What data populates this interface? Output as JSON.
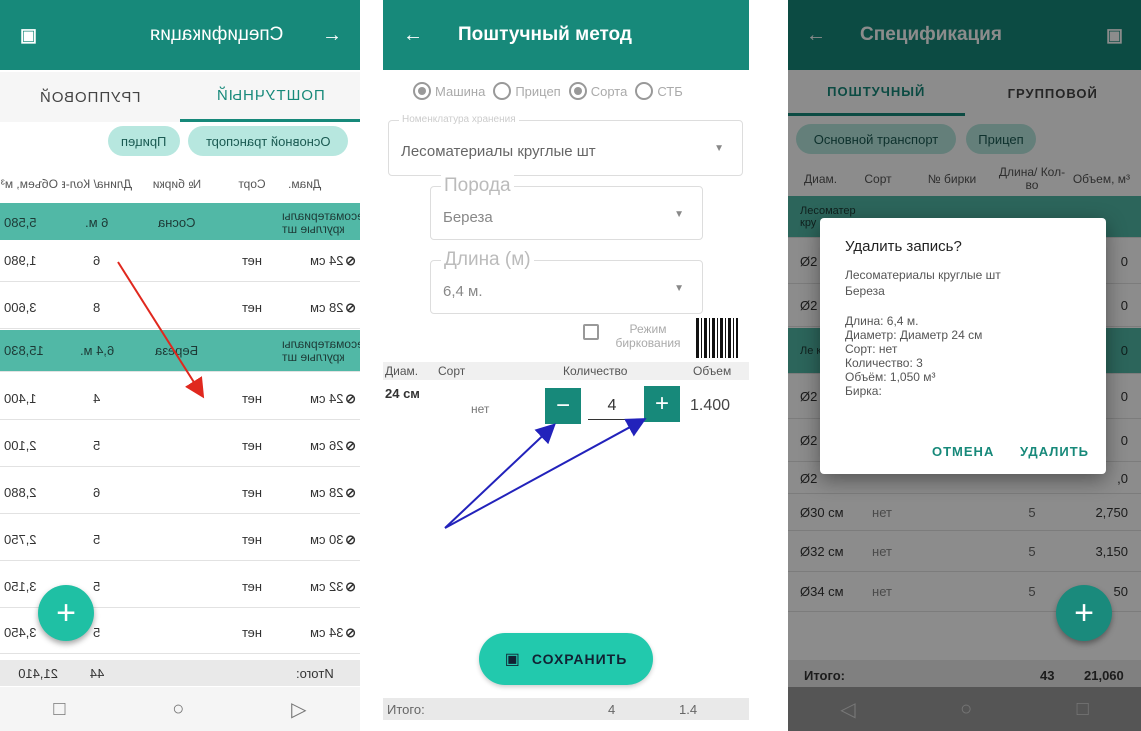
{
  "phone1": {
    "title": "Спецификация",
    "tabs": [
      "Групповой",
      "Поштучный"
    ],
    "chips": [
      "Прицеп",
      "Основной транспорт"
    ],
    "columns": [
      "Объем, м³",
      "Длина/ Кол-во",
      "№ бирки",
      "Сорт",
      "Диам."
    ],
    "rows": [
      {
        "type": "group",
        "volume": "5,580",
        "count": "6 м.",
        "tag": "Сосна",
        "sort": "",
        "diam": "Лесоматериалы круглые шт"
      },
      {
        "type": "item",
        "volume": "1,980",
        "count": "6",
        "tag": "",
        "sort": "нет",
        "diam": "24 см"
      },
      {
        "type": "item",
        "volume": "3,600",
        "count": "8",
        "tag": "",
        "sort": "нет",
        "diam": "28 см"
      },
      {
        "type": "group",
        "volume": "15,830",
        "count": "6,4 м.",
        "tag": "Береза",
        "sort": "",
        "diam": "Лесоматериалы круглые шт"
      },
      {
        "type": "item",
        "volume": "1,400",
        "count": "4",
        "tag": "",
        "sort": "нет",
        "diam": "24 см"
      },
      {
        "type": "item",
        "volume": "2,100",
        "count": "5",
        "tag": "",
        "sort": "нет",
        "diam": "26 см"
      },
      {
        "type": "item",
        "volume": "2,880",
        "count": "6",
        "tag": "",
        "sort": "нет",
        "diam": "28 см"
      },
      {
        "type": "item",
        "volume": "2,750",
        "count": "5",
        "tag": "",
        "sort": "нет",
        "diam": "30 см"
      },
      {
        "type": "item",
        "volume": "3,150",
        "count": "5",
        "tag": "",
        "sort": "нет",
        "diam": "32 см"
      },
      {
        "type": "item",
        "volume": "3,450",
        "count": "5",
        "tag": "",
        "sort": "нет",
        "diam": "34 см"
      }
    ],
    "totals": {
      "volume": "21,410",
      "count": "44",
      "label": "Итого:"
    }
  },
  "phone2": {
    "title": "Поштучный метод",
    "radios": [
      {
        "label": "Машина",
        "checked": true
      },
      {
        "label": "Прицеп",
        "checked": false
      },
      {
        "label": "Сорта",
        "checked": true
      },
      {
        "label": "СТБ",
        "checked": false
      }
    ],
    "nomenclature": {
      "label": "Номенклатура хранения",
      "value": "Лесоматериалы круглые шт"
    },
    "species": {
      "label": "Порода",
      "value": "Береза"
    },
    "length": {
      "label": "Длина (м)",
      "value": "6,4 м."
    },
    "tag_mode": "Режим биркования",
    "columns": {
      "diam": "Диам.",
      "sort": "Сорт",
      "qty": "Количество",
      "vol": "Объем"
    },
    "row": {
      "diam": "24 см",
      "sort": "нет",
      "qty": "4",
      "vol": "1.400"
    },
    "save_label": "СОХРАНИТЬ",
    "totals": {
      "label": "Итого:",
      "qty": "4",
      "vol": "1.4"
    }
  },
  "phone3": {
    "title": "Спецификация",
    "tabs": [
      "ПОШТУЧНЫЙ",
      "ГРУППОВОЙ"
    ],
    "chips": [
      "Основной транспорт",
      "Прицеп"
    ],
    "columns": [
      "Диам.",
      "Сорт",
      "№ бирки",
      "Длина/ Кол-во",
      "Объем, м³"
    ],
    "rows": [
      {
        "type": "group",
        "diam": "Лесоматериалы кру",
        "sort": "",
        "count": "",
        "volume": ""
      },
      {
        "type": "item",
        "diam": "Ø2",
        "sort": "",
        "count": "",
        "volume": "0"
      },
      {
        "type": "item",
        "diam": "Ø2",
        "sort": "",
        "count": "",
        "volume": "0"
      },
      {
        "type": "group",
        "diam": "Ле кру",
        "sort": "",
        "count": "",
        "volume": "0"
      },
      {
        "type": "item",
        "diam": "Ø2",
        "sort": "",
        "count": "",
        "volume": "0"
      },
      {
        "type": "item",
        "diam": "Ø2",
        "sort": "",
        "count": "",
        "volume": "0"
      },
      {
        "type": "item",
        "diam": "Ø2",
        "sort": "",
        "count": "",
        "volume": ",0"
      },
      {
        "type": "item",
        "diam": "Ø30 см",
        "sort": "нет",
        "count": "5",
        "volume": "2,750"
      },
      {
        "type": "item",
        "diam": "Ø32 см",
        "sort": "нет",
        "count": "5",
        "volume": "3,150"
      },
      {
        "type": "item",
        "diam": "Ø34 см",
        "sort": "нет",
        "count": "5",
        "volume": "50"
      }
    ],
    "totals": {
      "label": "Итого:",
      "count": "43",
      "volume": "21,060"
    },
    "dialog": {
      "title": "Удалить запись?",
      "line1": "Лесоматериалы круглые шт",
      "line2": "Береза",
      "details": [
        "Длина: 6,4 м.",
        "Диаметр: Диаметр 24 см",
        "Сорт: нет",
        "Количество: 3",
        "Объём: 1,050 м³",
        "Бирка:"
      ],
      "cancel": "ОТМЕНА",
      "delete": "УДАЛИТЬ"
    }
  },
  "colors": {
    "primary": "#17897a",
    "accent": "#1fc0a4",
    "group_row": "#51b8a6",
    "arrow_red": "#e0281e",
    "arrow_blue": "#2222bb"
  }
}
